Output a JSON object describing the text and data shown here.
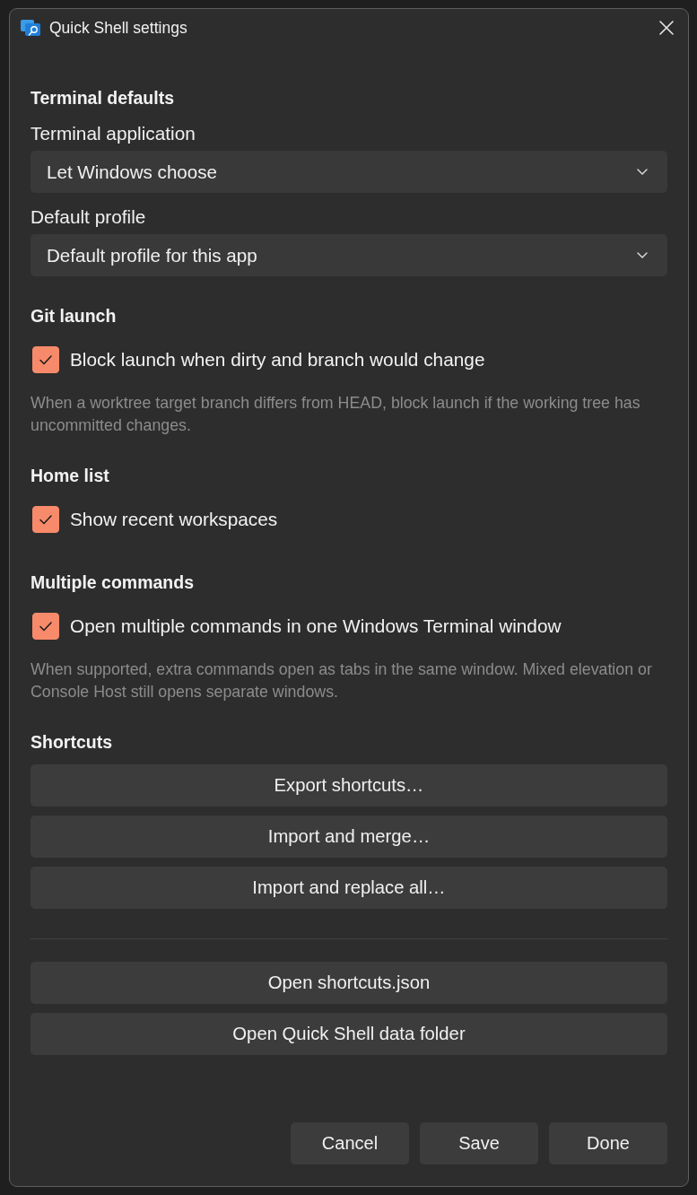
{
  "window": {
    "title": "Quick Shell settings"
  },
  "sections": [
    {
      "heading": "Terminal defaults",
      "items": [
        {
          "kind": "dropdown",
          "label": "Terminal application",
          "value": "Let Windows choose"
        },
        {
          "kind": "dropdown",
          "label": "Default profile",
          "value": "Default profile for this app"
        }
      ]
    },
    {
      "heading": "Git launch",
      "items": [
        {
          "kind": "checkbox",
          "label": "Block launch when dirty and branch would change",
          "checked": true
        },
        {
          "kind": "note",
          "text": "When a worktree target branch differs from HEAD, block launch if the working tree has uncommitted changes."
        }
      ]
    },
    {
      "heading": "Home list",
      "items": [
        {
          "kind": "checkbox",
          "label": "Show recent workspaces",
          "checked": true
        }
      ]
    },
    {
      "heading": "Multiple commands",
      "items": [
        {
          "kind": "checkbox",
          "label": "Open multiple commands in one Windows Terminal window",
          "checked": true
        },
        {
          "kind": "note",
          "text": "When supported, extra commands open as tabs in the same window. Mixed elevation or Console Host still opens separate windows."
        }
      ]
    },
    {
      "heading": "Shortcuts",
      "items": [
        {
          "kind": "button",
          "label": "Export shortcuts…"
        },
        {
          "kind": "button",
          "label": "Import and merge…"
        },
        {
          "kind": "button",
          "label": "Import and replace all…"
        },
        {
          "kind": "divider"
        },
        {
          "kind": "button",
          "label": "Open shortcuts.json"
        },
        {
          "kind": "button",
          "label": "Open Quick Shell data folder"
        }
      ]
    }
  ],
  "footer_buttons": [
    "Cancel",
    "Save",
    "Done"
  ]
}
